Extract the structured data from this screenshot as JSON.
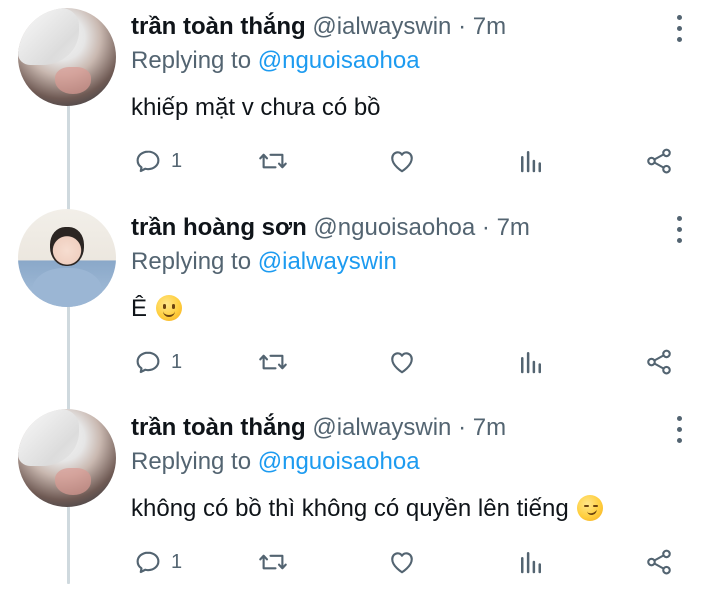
{
  "tweets": [
    {
      "name": "trần toàn thắng",
      "handle": "@ialwayswin",
      "separator": "·",
      "time": "7m",
      "replying_label": "Replying to",
      "replying_to": "@nguoisaohoa",
      "text": "khiếp mặt v chưa có bồ",
      "emoji": "",
      "reply_count": "1"
    },
    {
      "name": "trần hoàng sơn",
      "handle": "@nguoisaohoa",
      "separator": "·",
      "time": "7m",
      "replying_label": "Replying to",
      "replying_to": "@ialwayswin",
      "text": "Ê",
      "emoji": "slightly-smiling-face",
      "reply_count": "1"
    },
    {
      "name": "trần toàn thắng",
      "handle": "@ialwayswin",
      "separator": "·",
      "time": "7m",
      "replying_label": "Replying to",
      "replying_to": "@nguoisaohoa",
      "text": "không có bồ thì không có quyền lên tiếng",
      "emoji": "smirking-face",
      "reply_count": "1"
    }
  ],
  "icons": {
    "reply": "reply-icon",
    "retweet": "retweet-icon",
    "like": "heart-icon",
    "views": "views-icon",
    "share": "share-icon",
    "more": "more-icon"
  },
  "colors": {
    "text": "#0f1419",
    "secondary": "#536471",
    "link": "#1d9bf0",
    "thread_line": "#cfd9de"
  }
}
